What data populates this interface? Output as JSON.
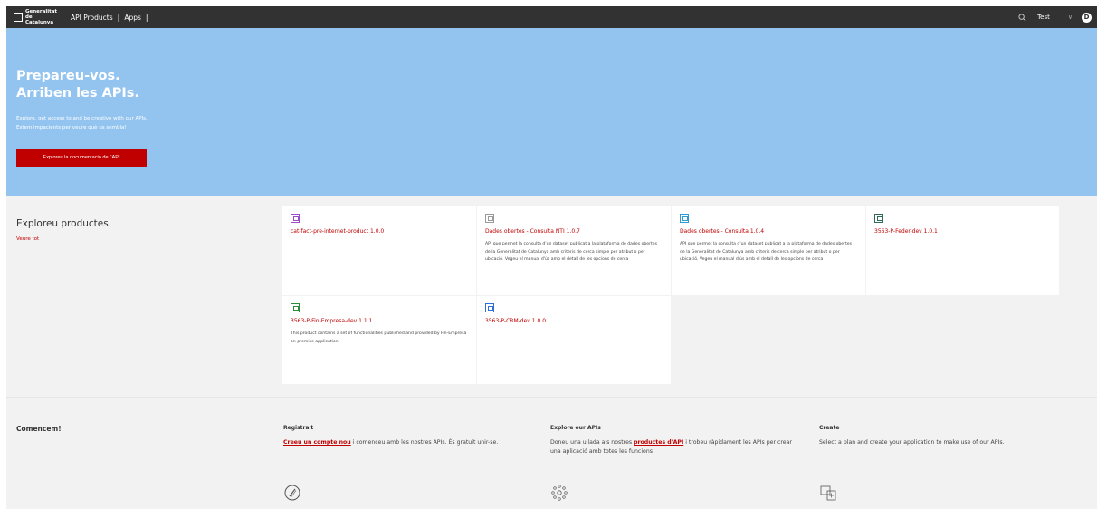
{
  "header": {
    "logo_text": "Generalitat de Catalunya",
    "nav": [
      "API Products",
      "Apps"
    ],
    "user": "Test",
    "avatar_letter": "D"
  },
  "hero": {
    "title_line1": "Preparеu-vos.",
    "title_line2": "Arriben les APIs.",
    "subtitle_line1": "Explore, get access to and be creative with our APIs.",
    "subtitle_line2": "Estem impacients per veure què us sembla!",
    "cta_label": "Exploreu la documentació de l'API"
  },
  "explore": {
    "heading": "Exploreu productes",
    "see_all": "Veure tot",
    "products": [
      {
        "title": "cat-fact-pre-internet-product 1.0.0",
        "desc": "",
        "icon_color": "#9b4dca"
      },
      {
        "title": "Dades obertes - Consulta NTI 1.0.7",
        "desc": "API que permet la consulta d'un dataset publicat a la plataforma de dades obertes de la Generalitat de Catalunya amb criteris de cerca simple per atribut o per ubicació. Vegeu el manual d'ús amb el detall de les opcions de cerca",
        "icon_color": "#9a9a9a"
      },
      {
        "title": "Dades obertes - Consulta 1.0.4",
        "desc": "API que permet la consulta d'un dataset publicat a la plataforma de dades obertes de la Generalitat de Catalunya amb criteris de cerca simple per atribut o per ubicació. Vegeu el manual d'ús amb el detall de les opcions de cerca",
        "icon_color": "#2b9bd6"
      },
      {
        "title": "3563-P-Feder-dev 1.0.1",
        "desc": "",
        "icon_color": "#2f6b55"
      },
      {
        "title": "3563-P-Fin-Empresa-dev 1.1.1",
        "desc": "This product contains a set of functionalities published and provided by Fin-Empresa on-premise application.",
        "icon_color": "#2e8b3a"
      },
      {
        "title": "3563-P-CRM-dev 1.0.0",
        "desc": "",
        "icon_color": "#2f6fd6"
      }
    ]
  },
  "get_started": {
    "heading": "Comencem!",
    "register": {
      "title": "Registra't",
      "link": "Creeu un compte nou",
      "text": " i comenceu amb les nostres APIs. És gratuït unir-se."
    },
    "explore_apis": {
      "title": "Explore our APIs",
      "prefix": "Doneu una ullada als nostres ",
      "link": "productes d'API",
      "text": " i trobeu ràpidament les APIs per crear una aplicació amb totes les funcions"
    },
    "create": {
      "title": "Create",
      "text": "Select a plan and create your application to make use of our APIs."
    }
  }
}
